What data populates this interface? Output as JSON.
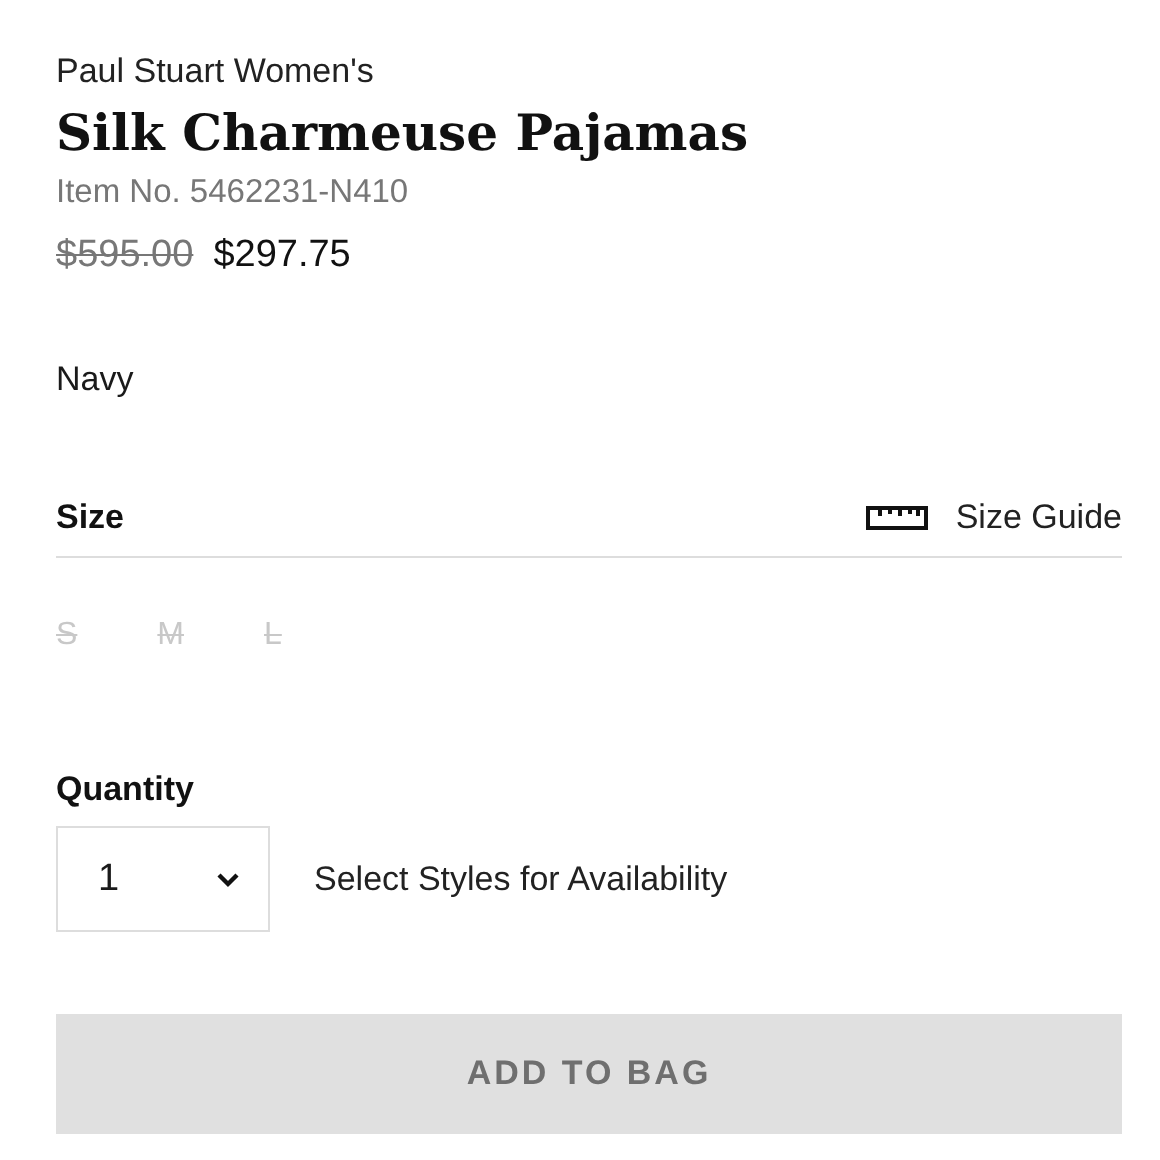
{
  "product": {
    "brand": "Paul Stuart Women's",
    "title": "Silk Charmeuse Pajamas",
    "item_number": "Item No. 5462231-N410",
    "original_price": "$595.00",
    "sale_price": "$297.75",
    "color_name": "Navy"
  },
  "size": {
    "label": "Size",
    "guide_label": "Size Guide",
    "options": [
      {
        "label": "S",
        "disabled": true
      },
      {
        "label": "M",
        "disabled": true
      },
      {
        "label": "L",
        "disabled": true
      }
    ]
  },
  "quantity": {
    "label": "Quantity",
    "value": "1",
    "availability": "Select Styles for Availability"
  },
  "add_button": {
    "label": "ADD TO BAG",
    "disabled": true
  }
}
